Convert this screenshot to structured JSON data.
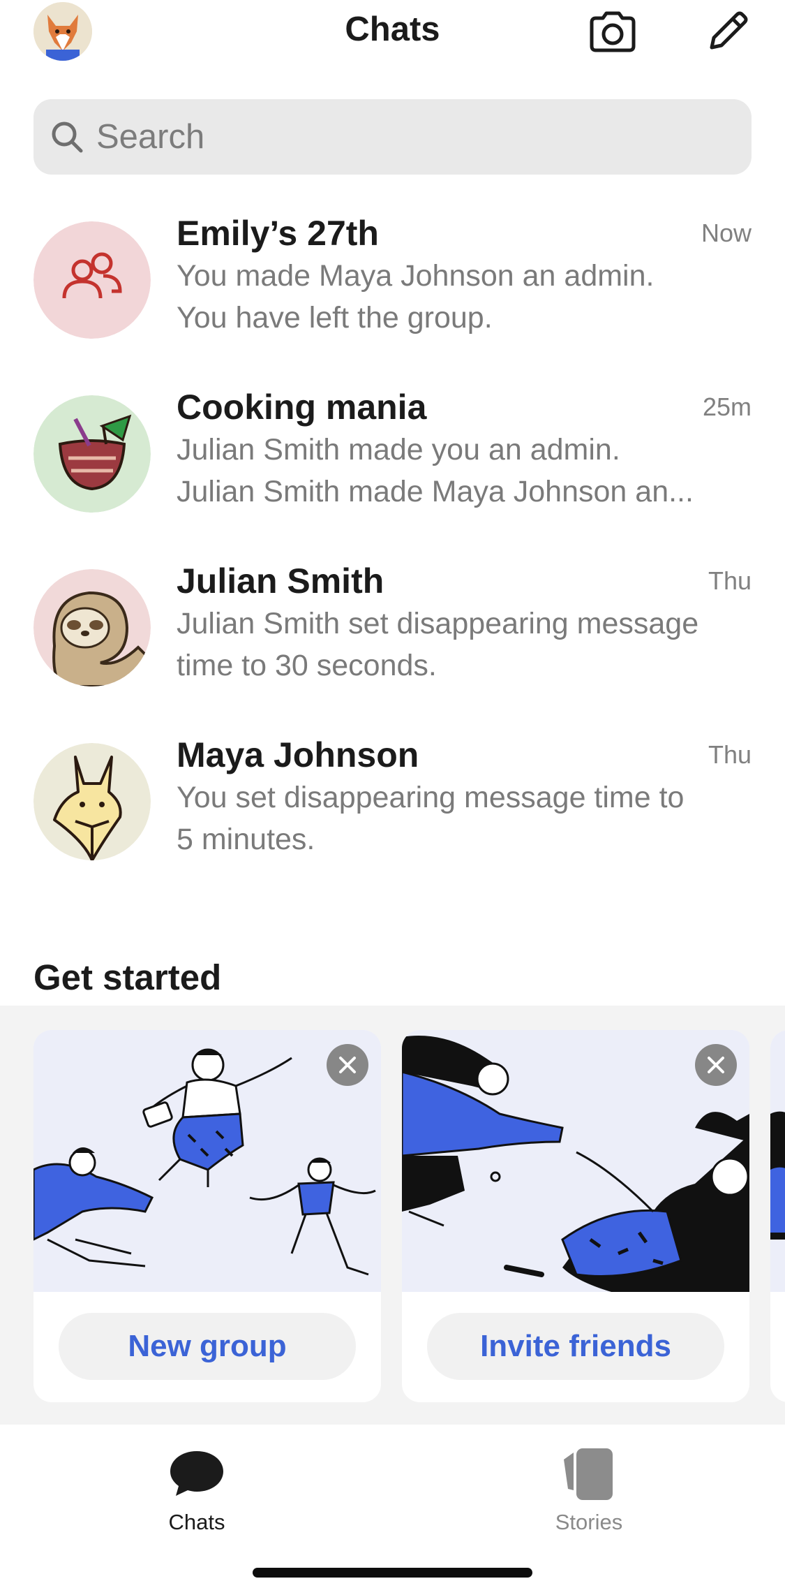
{
  "header": {
    "title": "Chats",
    "profile_icon": "fox-avatar-icon",
    "camera_icon": "camera-icon",
    "compose_icon": "pencil-icon"
  },
  "search": {
    "placeholder": "Search",
    "value": ""
  },
  "chats": [
    {
      "name": "Emily’s 27th",
      "time": "Now",
      "lines": [
        "You made Maya Johnson an admin.",
        "You have left the group."
      ],
      "avatar_icon": "group-icon",
      "avatar_bg": "#f2d6d8"
    },
    {
      "name": "Cooking mania",
      "time": "25m",
      "lines": [
        "Julian  Smith made you an admin.",
        "Julian  Smith made Maya Johnson an..."
      ],
      "avatar_icon": "coconut-drink-icon",
      "avatar_bg": "#d6ead2"
    },
    {
      "name": "Julian Smith",
      "time": "Thu",
      "lines": [
        "Julian  Smith set disappearing message",
        "time to 30 seconds."
      ],
      "avatar_icon": "sloth-icon",
      "avatar_bg": "#f1d9d9"
    },
    {
      "name": "Maya Johnson",
      "time": "Thu",
      "lines": [
        "You set disappearing message time to",
        "5 minutes."
      ],
      "avatar_icon": "fox-icon",
      "avatar_bg": "#ecead9"
    }
  ],
  "get_started": {
    "title": "Get started",
    "cards": [
      {
        "button_label": "New group",
        "illustration": "dancing-people-illustration"
      },
      {
        "button_label": "Invite friends",
        "illustration": "reaching-hands-illustration"
      }
    ]
  },
  "tabbar": {
    "chats_label": "Chats",
    "stories_label": "Stories"
  },
  "colors": {
    "accent": "#3b63d6",
    "illustration_blue": "#3f63e0"
  }
}
